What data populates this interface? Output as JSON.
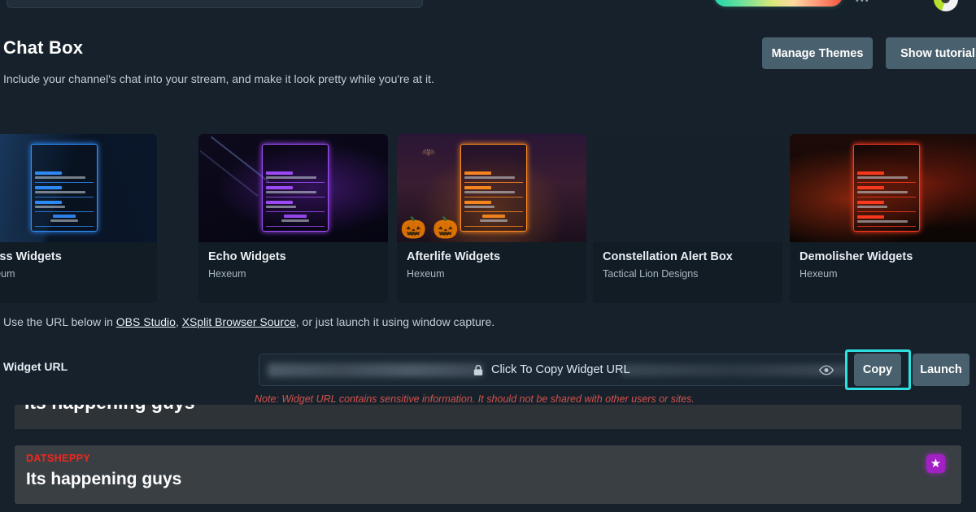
{
  "topbar": {
    "search_placeholder": "",
    "dots_label": "•••",
    "avatar_name": "user-avatar"
  },
  "header": {
    "title": "Chat Box",
    "subtitle": "Include your channel's chat into your stream, and make it look pretty while you're at it.",
    "manage_themes_label": "Manage Themes",
    "show_tutorial_label": "Show tutorial"
  },
  "widgets": [
    {
      "name": "Abyss Widgets",
      "author": "Hexeum",
      "accent": "#2f8fff"
    },
    {
      "name": "Echo Widgets",
      "author": "Hexeum",
      "accent": "#a24dff"
    },
    {
      "name": "Afterlife Widgets",
      "author": "Hexeum",
      "accent": "#ff8a1f"
    },
    {
      "name": "Constellation Alert Box",
      "author": "Tactical Lion Designs",
      "accent": "#4f7fae"
    },
    {
      "name": "Demolisher Widgets",
      "author": "Hexeum",
      "accent": "#ff3b20"
    }
  ],
  "url_section": {
    "instruction_prefix": "Use the URL below in ",
    "link_obs": "OBS Studio",
    "instruction_mid": ", ",
    "link_xsplit": "XSplit Browser Source",
    "instruction_suffix": ", or just launch it using window capture.",
    "field_label": "Widget URL",
    "copy_hint": "Click To Copy Widget URL",
    "copy_button_label": "Copy",
    "launch_button_label": "Launch",
    "note": "Note: Widget URL contains sensitive information. It should not be shared with other users or sites.",
    "note_color": "#d4524a",
    "highlight_color": "#2ee0e0"
  },
  "chat": {
    "clipped_message": "Its happening guys",
    "messages": [
      {
        "user": "DATSHEPPY",
        "user_color": "#f4261c",
        "text": "Its happening guys",
        "badge": "★",
        "badge_color": "#a221c4"
      }
    ]
  }
}
